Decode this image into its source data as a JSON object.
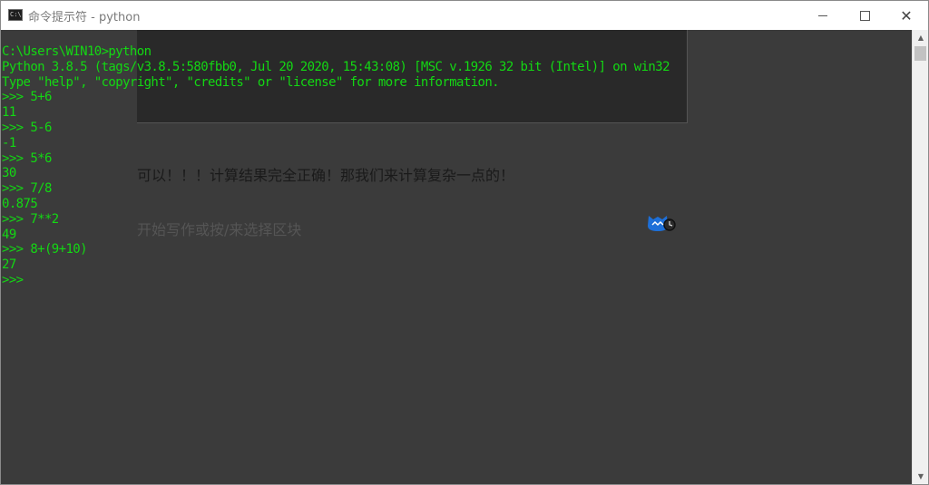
{
  "window": {
    "title": "命令提示符 - python",
    "icon": "cmd-icon",
    "controls": {
      "minimize": "minimize-icon",
      "maximize": "maximize-icon",
      "close": "close-icon"
    }
  },
  "console": {
    "lines": [
      "C:\\Users\\WIN10>python",
      "Python 3.8.5 (tags/v3.8.5:580fbb0, Jul 20 2020, 15:43:08) [MSC v.1926 32 bit (Intel)] on win32",
      "Type \"help\", \"copyright\", \"credits\" or \"license\" for more information.",
      ">>> 5+6",
      "11",
      ">>> 5-6",
      "-1",
      ">>> 5*6",
      "30",
      ">>> 7/8",
      "0.875",
      ">>> 7**2",
      "49",
      ">>> 8+(9+10)",
      "27",
      ">>>"
    ],
    "text_color": "#13d813",
    "background_color": "#3b3b3b"
  },
  "background_editor": {
    "text_1": "可以！！！计算结果完全正确！那我们来计算复杂一点的！",
    "text_2": "开始写作或按/来选择区块",
    "logo": "assistant-logo-icon"
  },
  "colors": {
    "accent_green": "#13d813",
    "logo_blue": "#1d6fd8"
  }
}
